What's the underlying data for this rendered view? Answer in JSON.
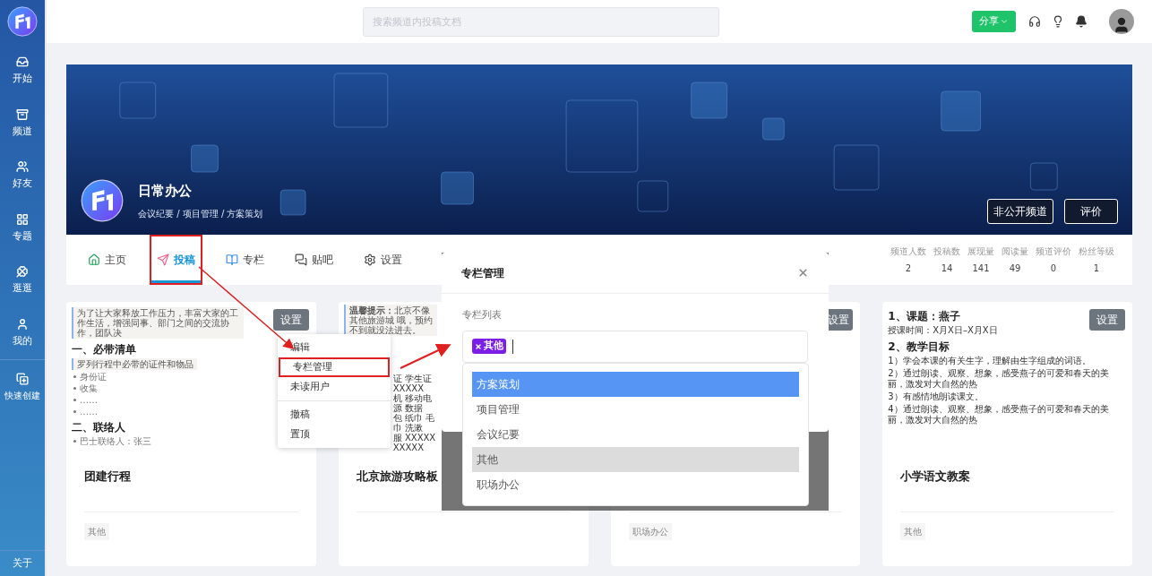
{
  "sidebar": {
    "items": [
      {
        "label": "开始"
      },
      {
        "label": "频道"
      },
      {
        "label": "好友"
      },
      {
        "label": "专题"
      },
      {
        "label": "逛逛"
      },
      {
        "label": "我的"
      }
    ],
    "create": {
      "label": "快速创建"
    },
    "footer": {
      "label": "关于"
    }
  },
  "topbar": {
    "search": {
      "placeholder": "搜索频道内投稿文档"
    },
    "share_button": "分享"
  },
  "banner": {
    "title": "日常办公",
    "subtitle": "会议纪要 / 项目管理 / 方案策划",
    "buttons": [
      "非公开频道",
      "评价"
    ]
  },
  "tabs": [
    {
      "label": "主页",
      "selected": false,
      "framed": false
    },
    {
      "label": "投稿",
      "selected": true,
      "framed": true
    },
    {
      "label": "专栏",
      "selected": false,
      "framed": false
    },
    {
      "label": "贴吧",
      "selected": false,
      "framed": false
    },
    {
      "label": "设置",
      "selected": false,
      "framed": false
    }
  ],
  "stats": [
    {
      "label": "频道人数",
      "value": "2"
    },
    {
      "label": "投稿数",
      "value": "14"
    },
    {
      "label": "展现量",
      "value": "141"
    },
    {
      "label": "阅读量",
      "value": "49"
    },
    {
      "label": "频道评价",
      "value": "0"
    },
    {
      "label": "粉丝等级",
      "value": "1"
    }
  ],
  "cards": [
    {
      "settings": "设置",
      "preview": [
        {
          "kind": "note",
          "text": "为了让大家释放工作压力，丰富大家的工作生活，增强同事、部门之间的交流协作，团队决"
        },
        {
          "kind": "heading",
          "text": "一、必带清单"
        },
        {
          "kind": "note",
          "text": "罗列行程中必带的证件和物品"
        },
        {
          "kind": "bullet",
          "text": "身份证"
        },
        {
          "kind": "bullet",
          "text": "收集"
        },
        {
          "kind": "bullet",
          "text": "……"
        },
        {
          "kind": "bullet",
          "text": "……"
        },
        {
          "kind": "heading",
          "text": "二、联络人"
        },
        {
          "kind": "bullet",
          "text": "巴士联络人：张三"
        }
      ],
      "title": "团建行程",
      "tag": "其他"
    },
    {
      "preview": [
        {
          "kind": "note",
          "text": "**温馨提示：**北京不像其他旅游城 哦，预约不到就没法进去。"
        },
        {
          "kind": "fragment",
          "text": "证 学生证 XXXXX"
        },
        {
          "kind": "fragment",
          "text": "机 移动电源 数据"
        },
        {
          "kind": "fragment",
          "text": "包 纸巾 毛巾 洗漱"
        },
        {
          "kind": "fragment",
          "text": "服 XXXXX"
        },
        {
          "kind": "fragment",
          "text": "XXXXX"
        }
      ],
      "title": "北京旅游攻略板"
    },
    {
      "settings": "设置",
      "tag": "职场办公"
    },
    {
      "settings": "设置",
      "preview": [
        {
          "kind": "heading",
          "text": "1、课题：燕子"
        },
        {
          "kind": "line",
          "text": "授课时间：X月X日–X月X日"
        },
        {
          "kind": "heading",
          "text": "2、教学目标"
        },
        {
          "kind": "line",
          "text": "1）学会本课的有关生字，理解由生字组成的词语。"
        },
        {
          "kind": "line",
          "text": "2）通过朗读、观察、想象，感受燕子的可爱和春天的美丽，激发对大自然的热"
        },
        {
          "kind": "line",
          "text": "3）有感情地朗读课文。"
        },
        {
          "kind": "line",
          "text": "4）通过朗读、观察、想象，感受燕子的可爱和春天的美丽，激发对大自然的热"
        }
      ],
      "title": "小学语文教案",
      "tag": "其他"
    }
  ],
  "context_menu": {
    "groups": [
      [
        {
          "label": "编辑",
          "framed": false
        },
        {
          "label": "专栏管理",
          "framed": true
        },
        {
          "label": "未读用户",
          "framed": false
        }
      ],
      [
        {
          "label": "撤稿",
          "framed": false
        },
        {
          "label": "置顶",
          "framed": false
        }
      ]
    ]
  },
  "modal": {
    "title": "专栏管理",
    "field_label": "专栏列表",
    "tags": [
      "其他"
    ],
    "options": [
      {
        "label": "方案策划",
        "highlighted": true,
        "selected": false
      },
      {
        "label": "项目管理",
        "highlighted": false,
        "selected": false
      },
      {
        "label": "会议纪要",
        "highlighted": false,
        "selected": false
      },
      {
        "label": "其他",
        "highlighted": false,
        "selected": true
      },
      {
        "label": "职场办公",
        "highlighted": false,
        "selected": false
      }
    ]
  }
}
